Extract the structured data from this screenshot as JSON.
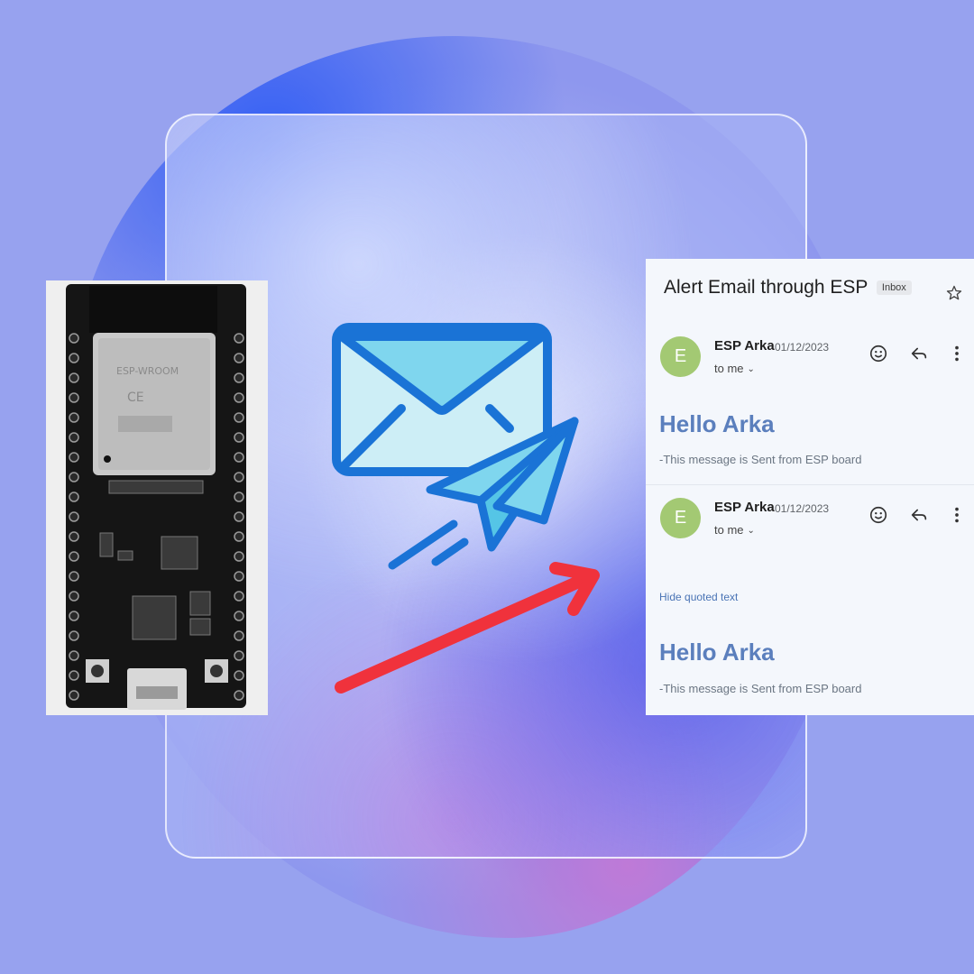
{
  "email": {
    "subject": "Alert Email through ESP",
    "badge": "Inbox",
    "messages": [
      {
        "avatar_letter": "E",
        "sender": "ESP Arka",
        "date": "01/12/2023",
        "recipient": "to me",
        "greeting": "Hello Arka",
        "body": "-This message is Sent from ESP board"
      },
      {
        "avatar_letter": "E",
        "sender": "ESP Arka",
        "date": "01/12/2023",
        "recipient": "to me",
        "hide_quoted": "Hide quoted text",
        "greeting": "Hello Arka",
        "body": "-This message is Sent from ESP board"
      }
    ]
  },
  "colors": {
    "background": "#97a2ef",
    "avatar": "#a3c973",
    "greeting": "#5b7fbd",
    "envelope_fill": "#7fd6ee",
    "envelope_stroke": "#1a73d6",
    "arrow": "#f0323c"
  },
  "icons": [
    "envelope-icon",
    "paper-plane-icon",
    "star-icon",
    "emoji-icon",
    "reply-icon",
    "more-vert-icon",
    "chevron-down-icon",
    "esp32-board"
  ]
}
